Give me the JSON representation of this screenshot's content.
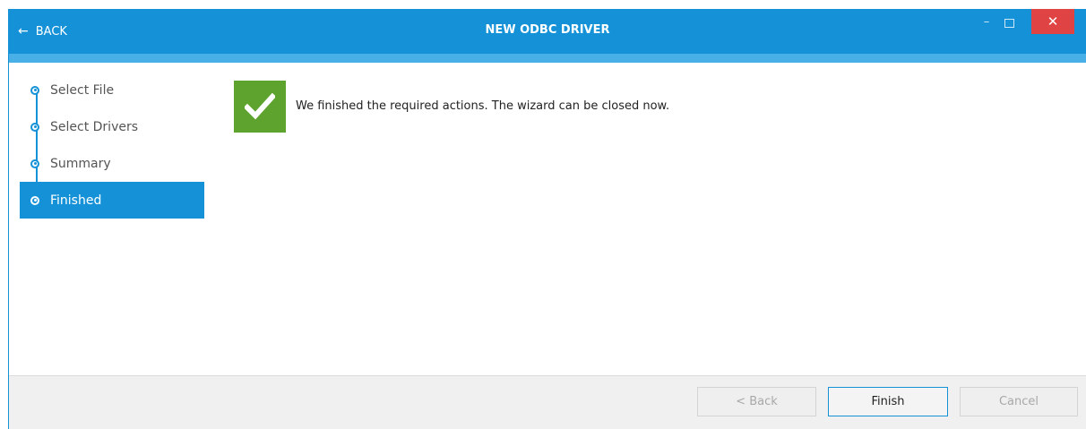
{
  "titlebar": {
    "back_label": "BACK",
    "title": "NEW ODBC DRIVER",
    "controls": [
      "minimize",
      "maximize",
      "close"
    ]
  },
  "steps": [
    {
      "label": "Select File",
      "active": false
    },
    {
      "label": "Select Drivers",
      "active": false
    },
    {
      "label": "Summary",
      "active": false
    },
    {
      "label": "Finished",
      "active": true
    }
  ],
  "main": {
    "status_icon": "checkmark-icon",
    "message": "We finished the required actions. The wizard can be closed now."
  },
  "footer": {
    "back_label": "< Back",
    "finish_label": "Finish",
    "cancel_label": "Cancel"
  },
  "colors": {
    "accent": "#1592d7",
    "accent_light": "#48b0e6",
    "success": "#5ea32d",
    "close": "#e04343"
  }
}
